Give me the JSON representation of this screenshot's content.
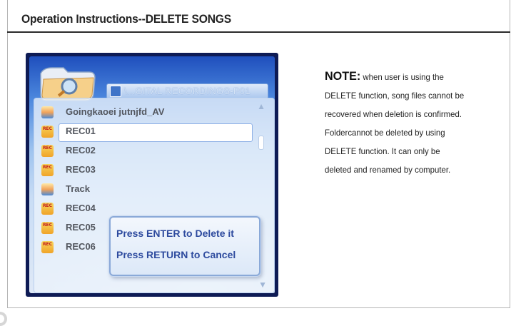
{
  "header": {
    "title": "Operation Instructions--DELETE SONGS"
  },
  "device_screen": {
    "path": "\\...GITAL RECORDINGS-P01",
    "items": [
      {
        "label": "Goingkaoei jutnjfd_AV",
        "icon": "av-file-icon"
      },
      {
        "label": "REC01",
        "icon": "rec-file-icon",
        "selected": true
      },
      {
        "label": "REC02",
        "icon": "rec-file-icon"
      },
      {
        "label": "REC03",
        "icon": "rec-file-icon"
      },
      {
        "label": "Track",
        "icon": "av-file-icon"
      },
      {
        "label": "REC04",
        "icon": "rec-file-icon"
      },
      {
        "label": "REC05",
        "icon": "rec-file-icon"
      },
      {
        "label": "REC06",
        "icon": "rec-file-icon"
      }
    ],
    "dialog": {
      "line1": "Press ENTER to Delete it",
      "line2": "Press RETURN to Cancel"
    }
  },
  "note": {
    "heading": "NOTE:",
    "line1": "when user is using the",
    "line2": "DELETE function, song files  cannot be",
    "line3": "recovered when deletion is confirmed.",
    "line4": "Foldercannot be deleted by using",
    "line5": "DELETE function. It can only be",
    "line6": "deleted and renamed by computer."
  },
  "colors": {
    "dialog_text": "#2d4a9e",
    "header_rule": "#2a2a2a",
    "screen_border": "#0e1b55"
  }
}
